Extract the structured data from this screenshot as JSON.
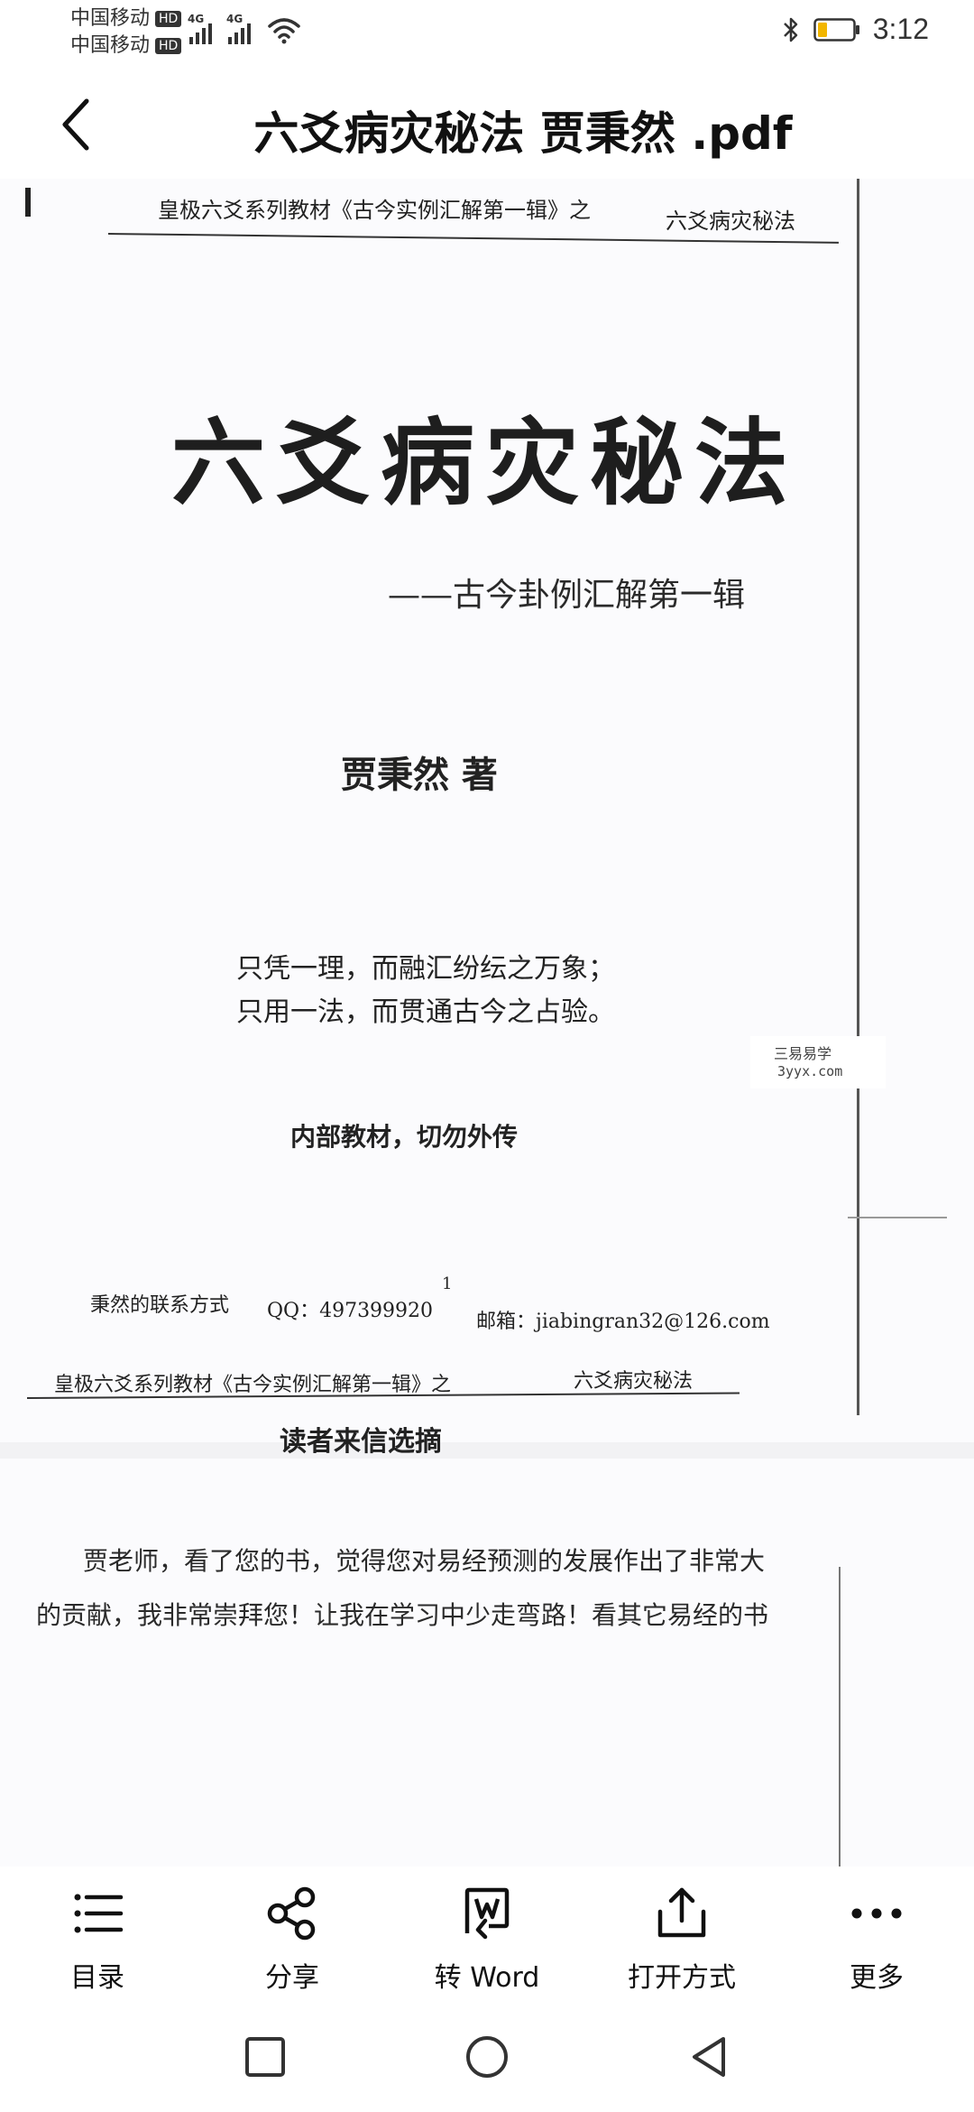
{
  "status_bar": {
    "carrier1": "中国移动",
    "carrier2": "中国移动",
    "hd_badge": "HD",
    "network": "4G",
    "time": "3:12"
  },
  "title_bar": {
    "title": "六爻病灾秘法 贾秉然 .pdf"
  },
  "document": {
    "page1": {
      "header_left": "皇极六爻系列教材《古今实例汇解第一辑》之",
      "header_right": "六爻病灾秘法",
      "main_title": "六爻病灾秘法",
      "subtitle": "——古今卦例汇解第一辑",
      "author": "贾秉然 著",
      "motto_line1": "只凭一理，而融汇纷纭之万象；",
      "motto_line2": "只用一法，而贯通古今之占验。",
      "internal_note": "内部教材，切勿外传",
      "contact_label": "秉然的联系方式",
      "contact_qq": "QQ：497399920",
      "contact_email": "邮箱：jiabingran32@126.com",
      "page_number": "1"
    },
    "page2": {
      "header_left": "皇极六爻系列教材《古今实例汇解第一辑》之",
      "header_right": "六爻病灾秘法",
      "section_title": "读者来信选摘",
      "para_line1": "贾老师，看了您的书，觉得您对易经预测的发展作出了非常大",
      "para_line2": "的贡献，我非常崇拜您！让我在学习中少走弯路！看其它易经的书"
    },
    "watermark": {
      "text": "三易易学",
      "url": "3yyx.com"
    }
  },
  "toolbar": {
    "items": [
      {
        "label": "目录",
        "icon": "list-icon"
      },
      {
        "label": "分享",
        "icon": "share-icon"
      },
      {
        "label": "转 Word",
        "icon": "word-icon"
      },
      {
        "label": "打开方式",
        "icon": "open-with-icon"
      },
      {
        "label": "更多",
        "icon": "more-icon"
      }
    ]
  },
  "nav_bar": {
    "buttons": [
      "recent-apps",
      "home",
      "back"
    ]
  }
}
